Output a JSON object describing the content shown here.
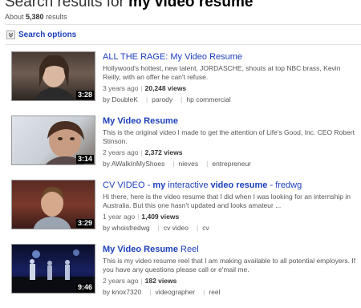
{
  "header": {
    "title_prefix": "Search results for ",
    "query": "my video resume",
    "about_prefix": "About ",
    "result_count": "5,380",
    "about_suffix": " results"
  },
  "search_options": {
    "label": "Search options"
  },
  "results": [
    {
      "title_prefix": "ALL THE RAGE: ",
      "title_bold": "My Video Resume",
      "title_suffix": "",
      "description": "Hollywood's hottest, new talent, JORDASCHE, shouts at top NBC brass, Kevin Reilly, with an offer he can't refuse.",
      "age": "3 years ago",
      "views": "20,248 views",
      "author": "DoubleK",
      "tags": [
        "parody",
        "hp commercial"
      ],
      "duration": "3:28"
    },
    {
      "title_prefix": "",
      "title_bold": "My Video Resume",
      "title_suffix": "",
      "description": "This is the original video I made to get the attention of Life's Good, Inc. CEO Robert Stinson.",
      "age": "2 years ago",
      "views": "2,372 views",
      "author": "AWalkInMyShoes",
      "tags": [
        "nieves",
        "entrepreneur"
      ],
      "duration": "3:14"
    },
    {
      "title_prefix": "CV VIDEO - ",
      "title_bold": "my",
      "title_mid": " interactive ",
      "title_bold2": "video resume",
      "title_suffix": " - fredwg",
      "description": "Hi there, here is the video resume that I did when I was looking for an internship in Australia. But this one hasn't updated and looks amateur ...",
      "age": "1 year ago",
      "views": "1,409 views",
      "author": "whoisfredwg",
      "tags": [
        "cv video",
        "cv"
      ],
      "duration": "3:29"
    },
    {
      "title_prefix": "",
      "title_bold": "My Video Resume",
      "title_suffix": " Reel",
      "description": "This is my video resume reel that I am making available to all potential employers. If you have any questions please call or e'mail me.",
      "age": "2 years ago",
      "views": "182 views",
      "author": "knox7320",
      "tags": [
        "videographer",
        "reel"
      ],
      "duration": "9:46"
    }
  ]
}
